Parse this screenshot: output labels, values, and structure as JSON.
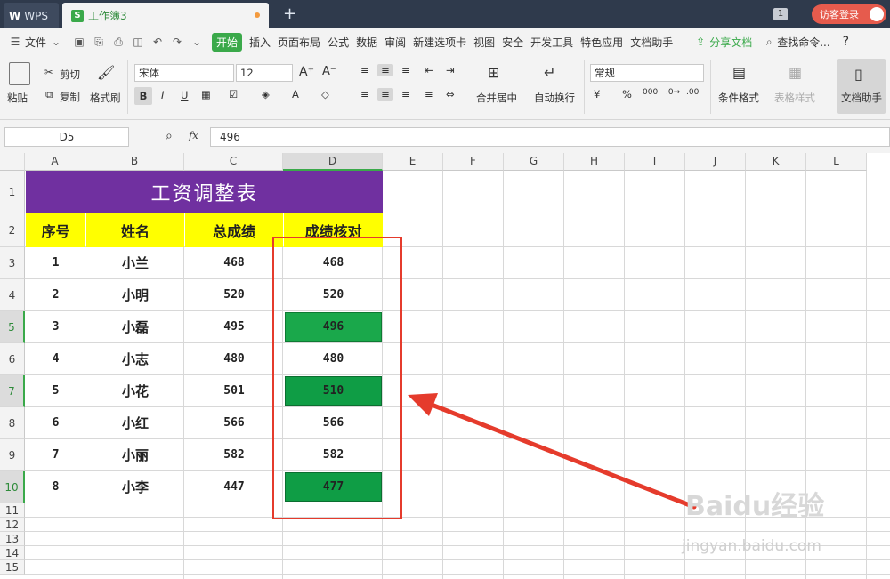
{
  "titlebar": {
    "app_tab": "WPS",
    "workbook_tab": "工作簿3",
    "window_count": "1",
    "visitor_login": "访客登录"
  },
  "menu": {
    "file": "文件",
    "items": [
      "开始",
      "插入",
      "页面布局",
      "公式",
      "数据",
      "审阅",
      "新建选项卡",
      "视图",
      "安全",
      "开发工具",
      "特色应用",
      "文档助手"
    ],
    "share": "分享文档",
    "search": "查找命令...",
    "help": "?"
  },
  "ribbon": {
    "paste": "粘贴",
    "cut": "剪切",
    "copy": "复制",
    "format_painter": "格式刷",
    "font_name": "宋体",
    "font_size": "12",
    "merge_center": "合并居中",
    "wrap_text": "自动换行",
    "number_format": "常规",
    "conditional_format": "条件格式",
    "table_style": "表格样式",
    "doc_assistant": "文档助手"
  },
  "formula_bar": {
    "name_box": "D5",
    "fx": "fx",
    "value": "496"
  },
  "sheet": {
    "columns": [
      "A",
      "B",
      "C",
      "D",
      "E",
      "F",
      "G",
      "H",
      "I",
      "J",
      "K",
      "L"
    ],
    "rows": [
      "1",
      "2",
      "3",
      "4",
      "5",
      "6",
      "7",
      "8",
      "9",
      "10",
      "11",
      "12",
      "13",
      "14",
      "15"
    ],
    "title": "工资调整表",
    "headers": [
      "序号",
      "姓名",
      "总成绩",
      "成绩核对"
    ],
    "data": [
      [
        "1",
        "小兰",
        "468",
        "468"
      ],
      [
        "2",
        "小明",
        "520",
        "520"
      ],
      [
        "3",
        "小磊",
        "495",
        "496"
      ],
      [
        "4",
        "小志",
        "480",
        "480"
      ],
      [
        "5",
        "小花",
        "501",
        "510"
      ],
      [
        "6",
        "小红",
        "566",
        "566"
      ],
      [
        "7",
        "小丽",
        "582",
        "582"
      ],
      [
        "8",
        "小李",
        "447",
        "477"
      ]
    ],
    "highlighted_rows": [
      2,
      4,
      7
    ],
    "highlight_color": "#1aa84b"
  },
  "watermark": {
    "logo": "Baidu经验",
    "url": "jingyan.baidu.com"
  }
}
